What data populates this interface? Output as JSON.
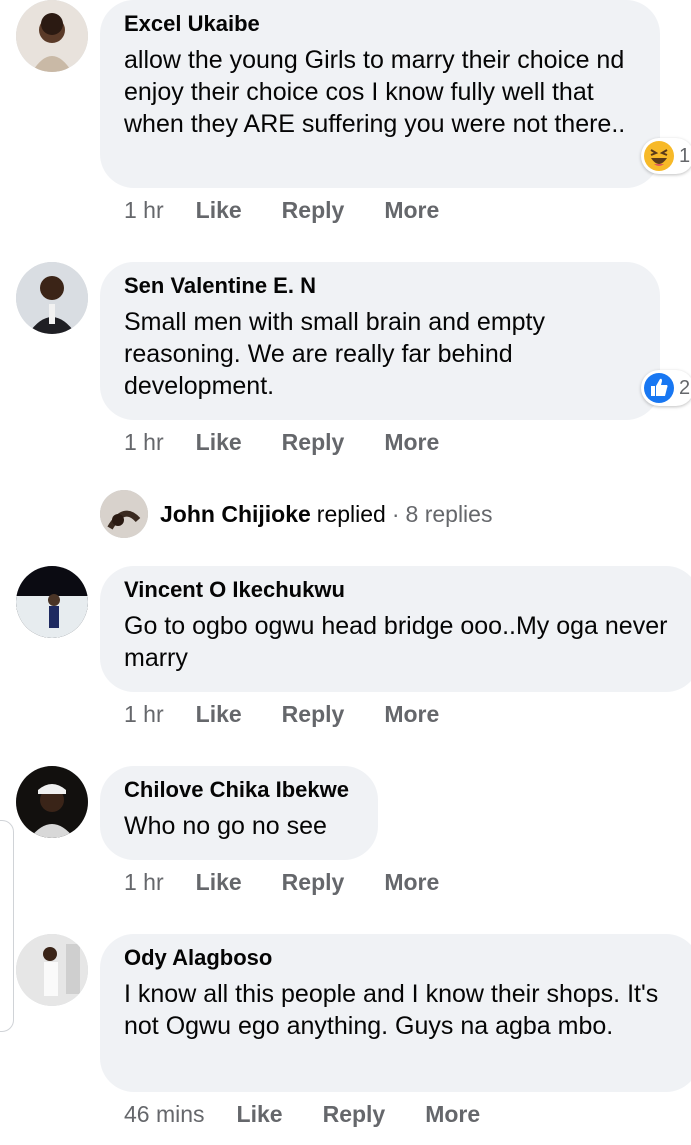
{
  "comments": [
    {
      "author": "Excel Ukaibe",
      "text": "allow the young Girls to marry their choice nd enjoy their choice cos I know fully well that when they ARE suffering you were not there..",
      "time": "1 hr",
      "reaction_icon": "haha-emoji-icon",
      "reaction_count": "1"
    },
    {
      "author": "Sen Valentine E. N",
      "text": "Small men with small brain and empty reasoning. We are really far behind development.",
      "time": "1 hr",
      "reaction_icon": "like-thumb-icon",
      "reaction_count": "2"
    },
    {
      "author": "Vincent O Ikechukwu",
      "text": "Go to ogbo ogwu head bridge ooo..My oga never marry",
      "time": "1 hr"
    },
    {
      "author": "Chilove Chika Ibekwe",
      "text": "Who no go no see",
      "time": "1 hr"
    },
    {
      "author": "Ody Alagboso",
      "text": "I know all this people and I know their shops. It's not Ogwu ego anything. Guys na agba mbo.",
      "time": "46 mins"
    }
  ],
  "actions": {
    "like": "Like",
    "reply": "Reply",
    "more": "More"
  },
  "replies": {
    "name": "John Chijioke",
    "verb": "replied",
    "sep": "·",
    "count": "8 replies"
  },
  "colors": {
    "bubble": "#f0f2f5",
    "meta": "#65676b",
    "like_blue": "#1877f2",
    "haha_yellow": "#f7b928"
  }
}
